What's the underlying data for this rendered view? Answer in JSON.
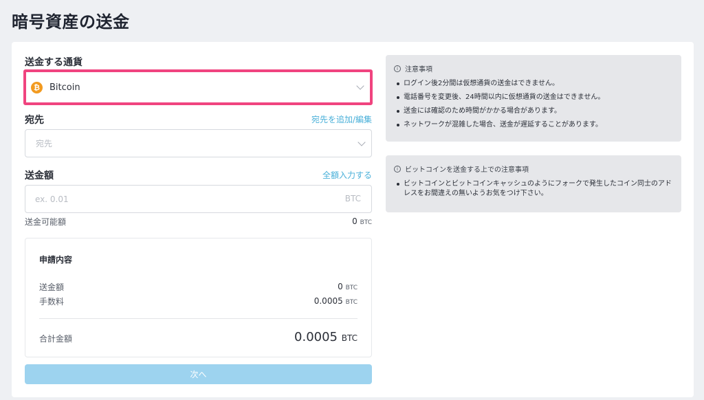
{
  "page": {
    "title": "暗号資産の送金"
  },
  "currency": {
    "label": "送金する通貨",
    "selected": "Bitcoin",
    "icon": "bitcoin-icon",
    "icon_color": "#f29a1f"
  },
  "destination": {
    "label": "宛先",
    "link": "宛先を追加/編集",
    "placeholder": "宛先"
  },
  "amount": {
    "label": "送金額",
    "link": "全額入力する",
    "placeholder": "ex. 0.01",
    "unit": "BTC",
    "available_label": "送金可能額",
    "available_value": "0",
    "available_unit": "BTC"
  },
  "summary": {
    "title": "申請内容",
    "rows": [
      {
        "label": "送金額",
        "value": "0",
        "unit": "BTC"
      },
      {
        "label": "手数料",
        "value": "0.0005",
        "unit": "BTC"
      }
    ],
    "total_label": "合計金額",
    "total_value": "0.0005",
    "total_unit": "BTC"
  },
  "next_button": {
    "label": "次へ",
    "color": "#9dd3ef"
  },
  "notices": [
    {
      "title": "注意事項",
      "items": [
        "ログイン後2分間は仮想通貨の送金はできません。",
        "電話番号を変更後、24時間以内に仮想通貨の送金はできません。",
        "送金には確認のため時間がかかる場合があります。",
        "ネットワークが混雑した場合、送金が遅延することがあります。"
      ]
    },
    {
      "title": "ビットコインを送金する上での注意事項",
      "items": [
        "ビットコインとビットコインキャッシュのようにフォークで発生したコイン同士のアドレスをお間違えの無いようお気をつけ下さい。"
      ]
    }
  ],
  "colors": {
    "highlight_border": "#f0447f",
    "link": "#4ab0d9",
    "background": "#eef0f3"
  }
}
